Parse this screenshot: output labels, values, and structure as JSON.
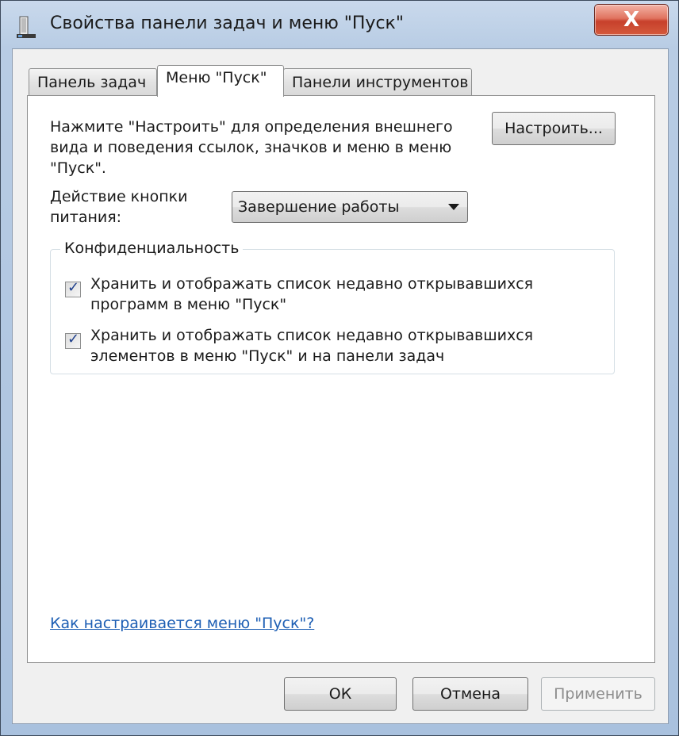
{
  "window": {
    "title": "Свойства панели задач и меню \"Пуск\"",
    "close_label": "X"
  },
  "tabs": [
    {
      "label": "Панель задач"
    },
    {
      "label": "Меню \"Пуск\""
    },
    {
      "label": "Панели инструментов"
    }
  ],
  "content": {
    "description_line1": "Нажмите \"Настроить\" для определения внешнего",
    "description_line2": "вида и поведения ссылок, значков и меню в меню",
    "description_line3": "\"Пуск\".",
    "customize_button": "Настроить...",
    "power_label_line1": "Действие кнопки",
    "power_label_line2": "питания:",
    "power_dropdown_value": "Завершение работы",
    "privacy": {
      "title": "Конфиденциальность",
      "items": [
        {
          "line1": "Хранить и отображать список недавно открывавшихся",
          "line2": "программ в меню \"Пуск\"",
          "checked": true
        },
        {
          "line1": "Хранить и отображать список недавно открывавшихся",
          "line2": "элементов в меню \"Пуск\" и на панели задач",
          "checked": true
        }
      ]
    },
    "help_link": "Как настраивается меню \"Пуск\"?"
  },
  "buttons": {
    "ok": "ОК",
    "cancel": "Отмена",
    "apply": "Применить"
  },
  "icons": {
    "window_icon": "taskbar-properties-icon",
    "checkbox_mark": "✓"
  }
}
